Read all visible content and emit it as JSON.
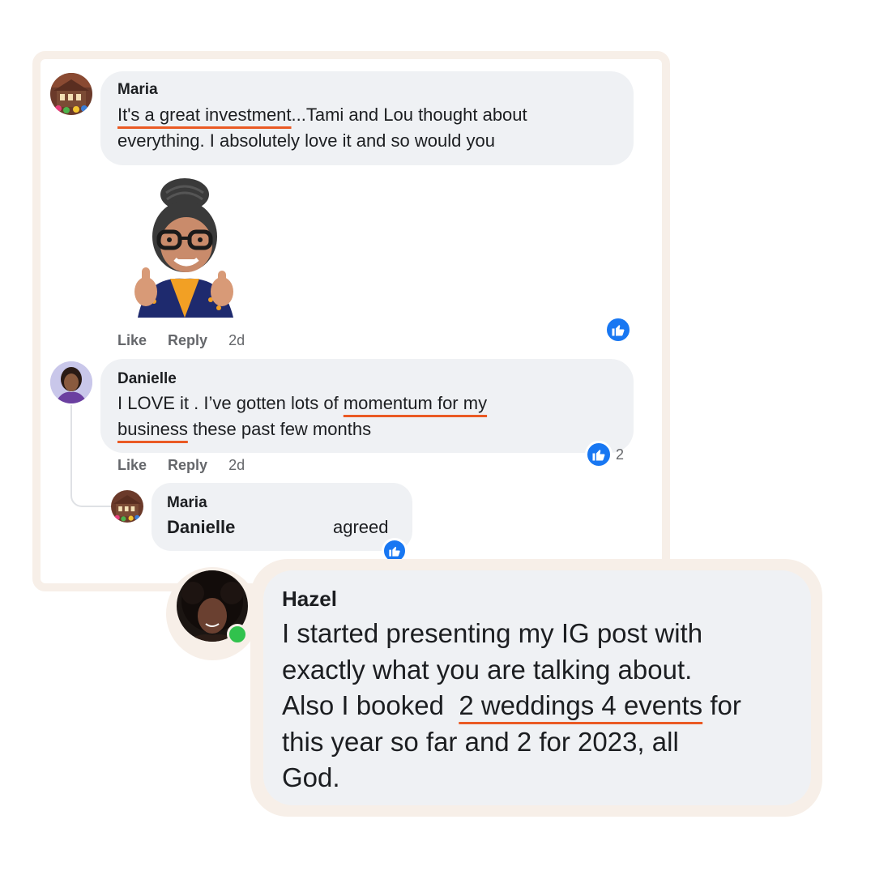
{
  "comments": [
    {
      "author": "Maria",
      "text_underlined": "It's a great investment",
      "text_rest_line1": "...Tami and Lou thought about",
      "text_line2": "everything. I absolutely love it and so would you",
      "actions": {
        "like": "Like",
        "reply": "Reply",
        "time": "2d"
      }
    },
    {
      "author": "Danielle",
      "text_pre": "I LOVE it . I’ve gotten lots of ",
      "text_underlined1": "momentum for my",
      "text_underlined2": "business",
      "text_post": " these past few months",
      "reaction_count": "2",
      "actions": {
        "like": "Like",
        "reply": "Reply",
        "time": "2d"
      }
    }
  ],
  "reply": {
    "author": "Maria",
    "mention": "Danielle",
    "text": "agreed"
  },
  "featured": {
    "author": "Hazel",
    "line1": "I started presenting my IG post with",
    "line2": "exactly what you are talking about.",
    "line3_pre": "Also I booked  ",
    "line3_underlined": "2 weddings 4 events",
    "line3_post": " for",
    "line4": "this year so far and 2 for 2023, all",
    "line5": "God."
  },
  "colors": {
    "underline": "#ea5a24",
    "like_blue": "#1877f2",
    "bubble": "#eff1f4",
    "frame": "#f7efe8",
    "online": "#31c24d"
  },
  "icons": [
    "thumbs-up-icon",
    "sticker-avatar-thumbs-up",
    "online-dot"
  ]
}
